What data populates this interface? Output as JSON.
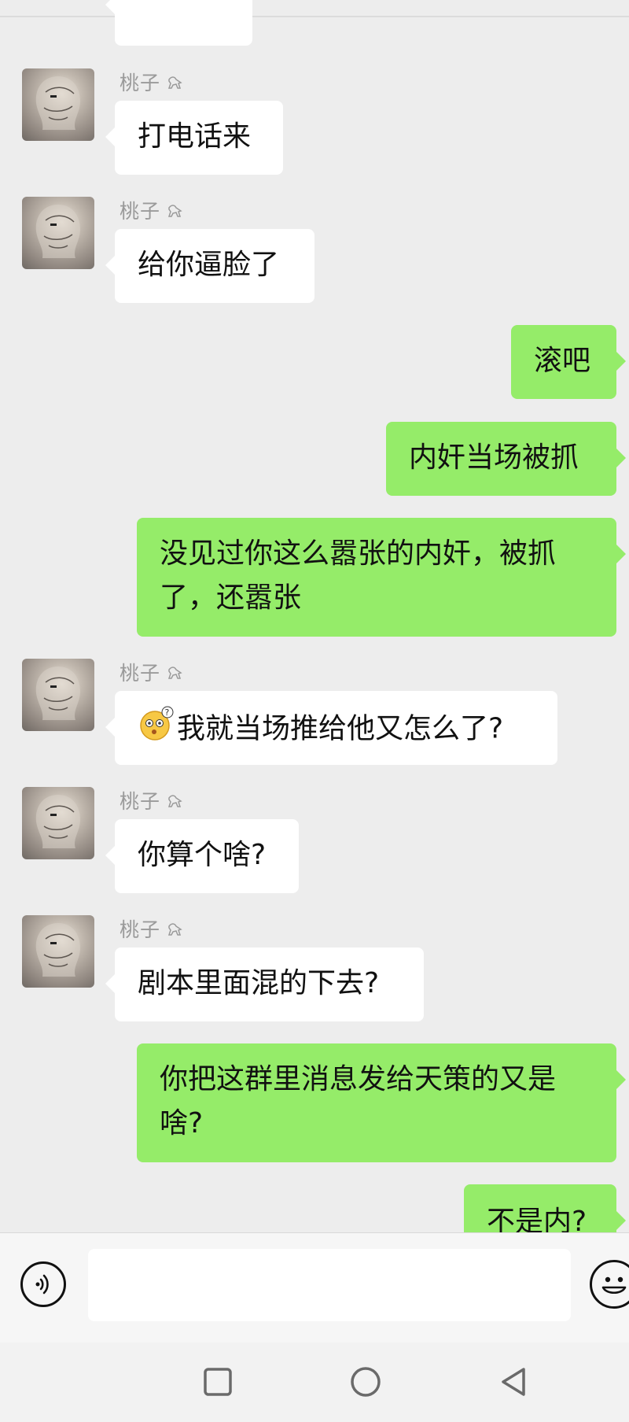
{
  "chat": {
    "messages": [
      {
        "side": "in",
        "sender": "桃子",
        "text": "打电话来"
      },
      {
        "side": "in",
        "sender": "桃子",
        "text": "给你逼脸了"
      },
      {
        "side": "out",
        "text": "滚吧"
      },
      {
        "side": "out",
        "text": "内奸当场被抓"
      },
      {
        "side": "out",
        "text": "没见过你这么嚣张的内奸，被抓了，还嚣张",
        "line1": "没见过你这么嚣张的内奸，被抓",
        "line2": "了，还嚣张"
      },
      {
        "side": "in",
        "sender": "桃子",
        "emoji": "thinking-confused-emoji",
        "text": "我就当场推给他又怎么了?"
      },
      {
        "side": "in",
        "sender": "桃子",
        "text": "你算个啥?"
      },
      {
        "side": "in",
        "sender": "桃子",
        "text": "剧本里面混的下去?"
      },
      {
        "side": "out",
        "text": "你把这群里消息发给天策的又是啥?",
        "line1": "你把这群里消息发给天策的又是",
        "line2": "啥?"
      },
      {
        "side": "out",
        "text": "不是内?"
      }
    ]
  },
  "input": {
    "voice_icon": "voice-icon",
    "text_value": "",
    "emoji_icon": "smile-icon"
  },
  "nav": {
    "icons": [
      "recents-square-icon",
      "home-circle-icon",
      "back-triangle-icon"
    ]
  },
  "colors": {
    "background": "#ededed",
    "outgoing_bubble": "#95ec69",
    "incoming_bubble": "#ffffff",
    "sender_name": "#9a9a9a"
  }
}
